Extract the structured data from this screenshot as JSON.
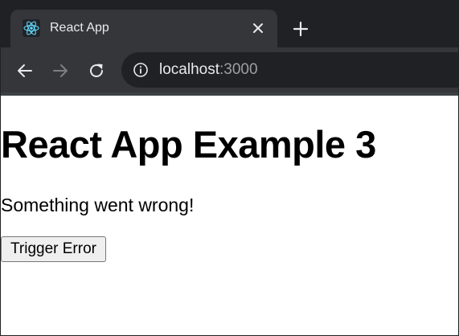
{
  "browser": {
    "tab": {
      "title": "React App",
      "favicon": "react-logo-icon"
    },
    "address_bar": {
      "host": "localhost",
      "port": ":3000"
    },
    "colors": {
      "tabstrip": "#202124",
      "active_tab": "#35363a",
      "text": "#e8eaed",
      "muted_text": "#9aa0a6",
      "react_accent": "#61dafb"
    },
    "icons": {
      "back": "arrow-left-icon",
      "forward": "arrow-right-icon",
      "reload": "reload-icon",
      "info": "info-icon",
      "close_tab": "close-icon",
      "new_tab": "plus-icon"
    }
  },
  "page": {
    "title": "React App Example 3",
    "error_message": "Something went wrong!",
    "trigger_button_label": "Trigger Error"
  }
}
